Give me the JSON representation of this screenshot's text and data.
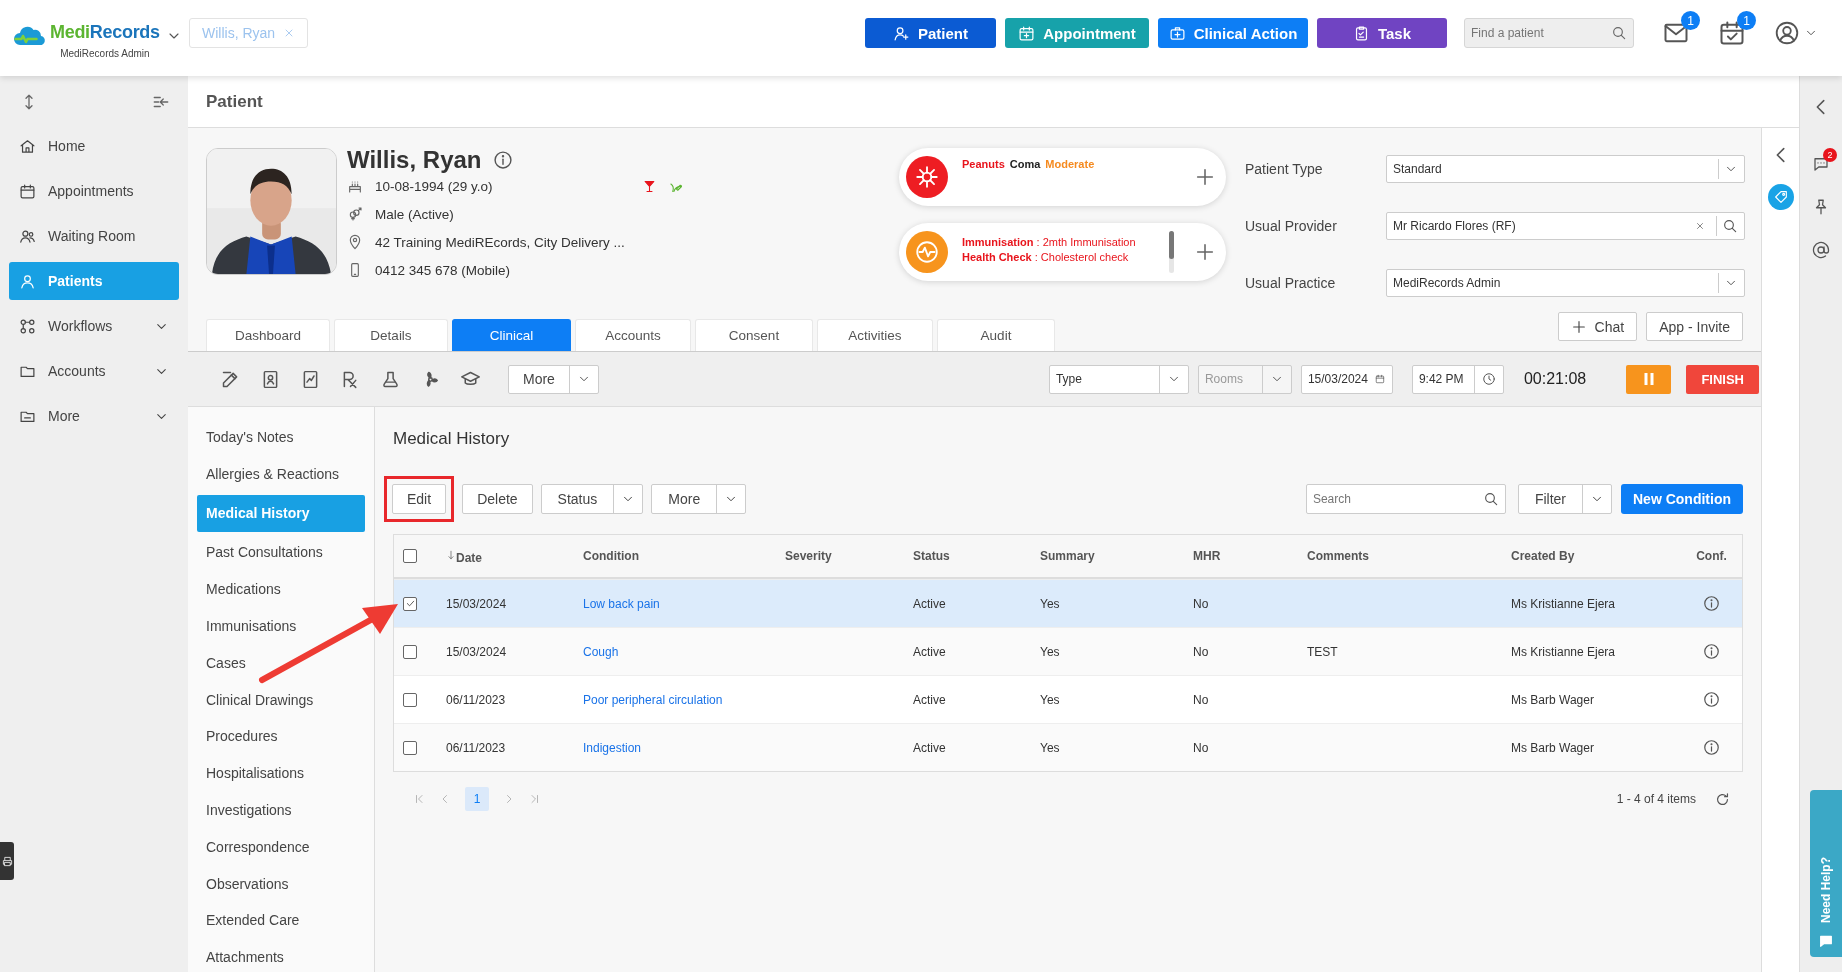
{
  "header": {
    "brand": [
      {
        "text": "Medi",
        "color": "#5cb531"
      },
      {
        "text": "Records",
        "color": "#1b75bb"
      }
    ],
    "subtitle": "MediRecords Admin",
    "open_patient": "Willis, Ryan",
    "actions": [
      {
        "label": "Patient",
        "color": "#0b5bd3"
      },
      {
        "label": "Appointment",
        "color": "#17a2aa"
      },
      {
        "label": "Clinical Action",
        "color": "#0d7ef5"
      },
      {
        "label": "Task",
        "color": "#7044c2"
      }
    ],
    "search": {
      "placeholder": "Find a patient"
    },
    "mail_badge": "1",
    "calendar_badge": "1"
  },
  "sidebar": {
    "items": [
      {
        "label": "Home",
        "selected": false,
        "submenu": false
      },
      {
        "label": "Appointments",
        "selected": false,
        "submenu": false
      },
      {
        "label": "Waiting Room",
        "selected": false,
        "submenu": false
      },
      {
        "label": "Patients",
        "selected": true,
        "submenu": false
      },
      {
        "label": "Workflows",
        "selected": false,
        "submenu": true
      },
      {
        "label": "Accounts",
        "selected": false,
        "submenu": true
      },
      {
        "label": "More",
        "selected": false,
        "submenu": true
      }
    ]
  },
  "page_title": "Patient",
  "patient": {
    "name": "Willis, Ryan",
    "dob": "10-08-1994 (29 y.o)",
    "gender": "Male (Active)",
    "address": "42 Training MediREcords, City Delivery ...",
    "phone": "0412 345 678 (Mobile)"
  },
  "alerts": [
    {
      "kind": "allergy",
      "segments": [
        {
          "text": "Peanuts",
          "color": "#e8141c"
        },
        {
          "text": "Coma",
          "color": "#222222"
        },
        {
          "text": "Moderate",
          "color": "#f58a1f"
        }
      ]
    },
    {
      "kind": "reminder",
      "lines": [
        "**Immunisation** : 2mth Immunisation",
        "**Health Check** : Cholesterol check"
      ]
    }
  ],
  "fields": [
    {
      "label": "Patient Type",
      "value": "Standard",
      "kind": "select"
    },
    {
      "label": "Usual Provider",
      "value": "Mr Ricardo Flores (RF)",
      "kind": "lookup"
    },
    {
      "label": "Usual Practice",
      "value": "MediRecords Admin",
      "kind": "select"
    }
  ],
  "panel_buttons": [
    {
      "label": "Chat",
      "kind": "add"
    },
    {
      "label": "App - Invite",
      "kind": "plain"
    }
  ],
  "tabs": [
    {
      "label": "Dashboard",
      "selected": false
    },
    {
      "label": "Details",
      "selected": false
    },
    {
      "label": "Clinical",
      "selected": true
    },
    {
      "label": "Accounts",
      "selected": false
    },
    {
      "label": "Consent",
      "selected": false
    },
    {
      "label": "Activities",
      "selected": false
    },
    {
      "label": "Audit",
      "selected": false
    }
  ],
  "toolbar": {
    "more": "More",
    "type": {
      "placeholder": "Type",
      "disabled": false
    },
    "rooms": {
      "placeholder": "Rooms",
      "disabled": true
    },
    "date": "15/03/2024",
    "time": "9:42 PM",
    "timer": "00:21:08",
    "finish": "FINISH"
  },
  "clinical_menu": [
    {
      "label": "Today's Notes",
      "selected": false
    },
    {
      "label": "Allergies & Reactions",
      "selected": false
    },
    {
      "label": "Medical History",
      "selected": true
    },
    {
      "label": "Past Consultations",
      "selected": false
    },
    {
      "label": "Medications",
      "selected": false
    },
    {
      "label": "Immunisations",
      "selected": false
    },
    {
      "label": "Cases",
      "selected": false
    },
    {
      "label": "Clinical Drawings",
      "selected": false
    },
    {
      "label": "Procedures",
      "selected": false
    },
    {
      "label": "Hospitalisations",
      "selected": false
    },
    {
      "label": "Investigations",
      "selected": false
    },
    {
      "label": "Correspondence",
      "selected": false
    },
    {
      "label": "Observations",
      "selected": false
    },
    {
      "label": "Extended Care",
      "selected": false
    },
    {
      "label": "Attachments",
      "selected": false
    }
  ],
  "section_title": "Medical History",
  "actions": [
    {
      "label": "Edit",
      "kind": "button"
    },
    {
      "label": "Delete",
      "kind": "button"
    },
    {
      "label": "Status",
      "kind": "split"
    },
    {
      "label": "More",
      "kind": "split"
    }
  ],
  "search": {
    "placeholder": "Search"
  },
  "filter": "Filter",
  "new_button": "New Condition",
  "table": {
    "columns": [
      {
        "label": "Date",
        "sorted": true
      },
      {
        "label": "Condition",
        "sorted": false
      },
      {
        "label": "Severity",
        "sorted": false
      },
      {
        "label": "Status",
        "sorted": false
      },
      {
        "label": "Summary",
        "sorted": false
      },
      {
        "label": "MHR",
        "sorted": false
      },
      {
        "label": "Comments",
        "sorted": false
      },
      {
        "label": "Created By",
        "sorted": false
      },
      {
        "label": "Conf.",
        "sorted": false
      }
    ],
    "all_checked": false,
    "rows": [
      {
        "selected": true,
        "checked": true,
        "date": "15/03/2024",
        "condition": "Low back pain",
        "status": "Active",
        "summary": "Yes",
        "mhr": "No",
        "created_by": "Ms Kristianne Ejera"
      },
      {
        "selected": false,
        "checked": false,
        "date": "15/03/2024",
        "condition": "Cough",
        "status": "Active",
        "summary": "Yes",
        "mhr": "No",
        "comments": "TEST",
        "created_by": "Ms Kristianne Ejera"
      },
      {
        "selected": false,
        "checked": false,
        "date": "06/11/2023",
        "condition": "Poor peripheral circulation",
        "status": "Active",
        "summary": "Yes",
        "mhr": "No",
        "created_by": "Ms Barb Wager"
      },
      {
        "selected": false,
        "checked": false,
        "date": "06/11/2023",
        "condition": "Indigestion",
        "status": "Active",
        "summary": "Yes",
        "mhr": "No",
        "created_by": "Ms Barb Wager"
      }
    ]
  },
  "pager": {
    "page": "1",
    "summary": "1 - 4 of 4 items"
  },
  "rail": {
    "chat_badge": "2",
    "help": "Need Help?"
  },
  "annotation": {
    "arrow": true,
    "highlight": true
  }
}
